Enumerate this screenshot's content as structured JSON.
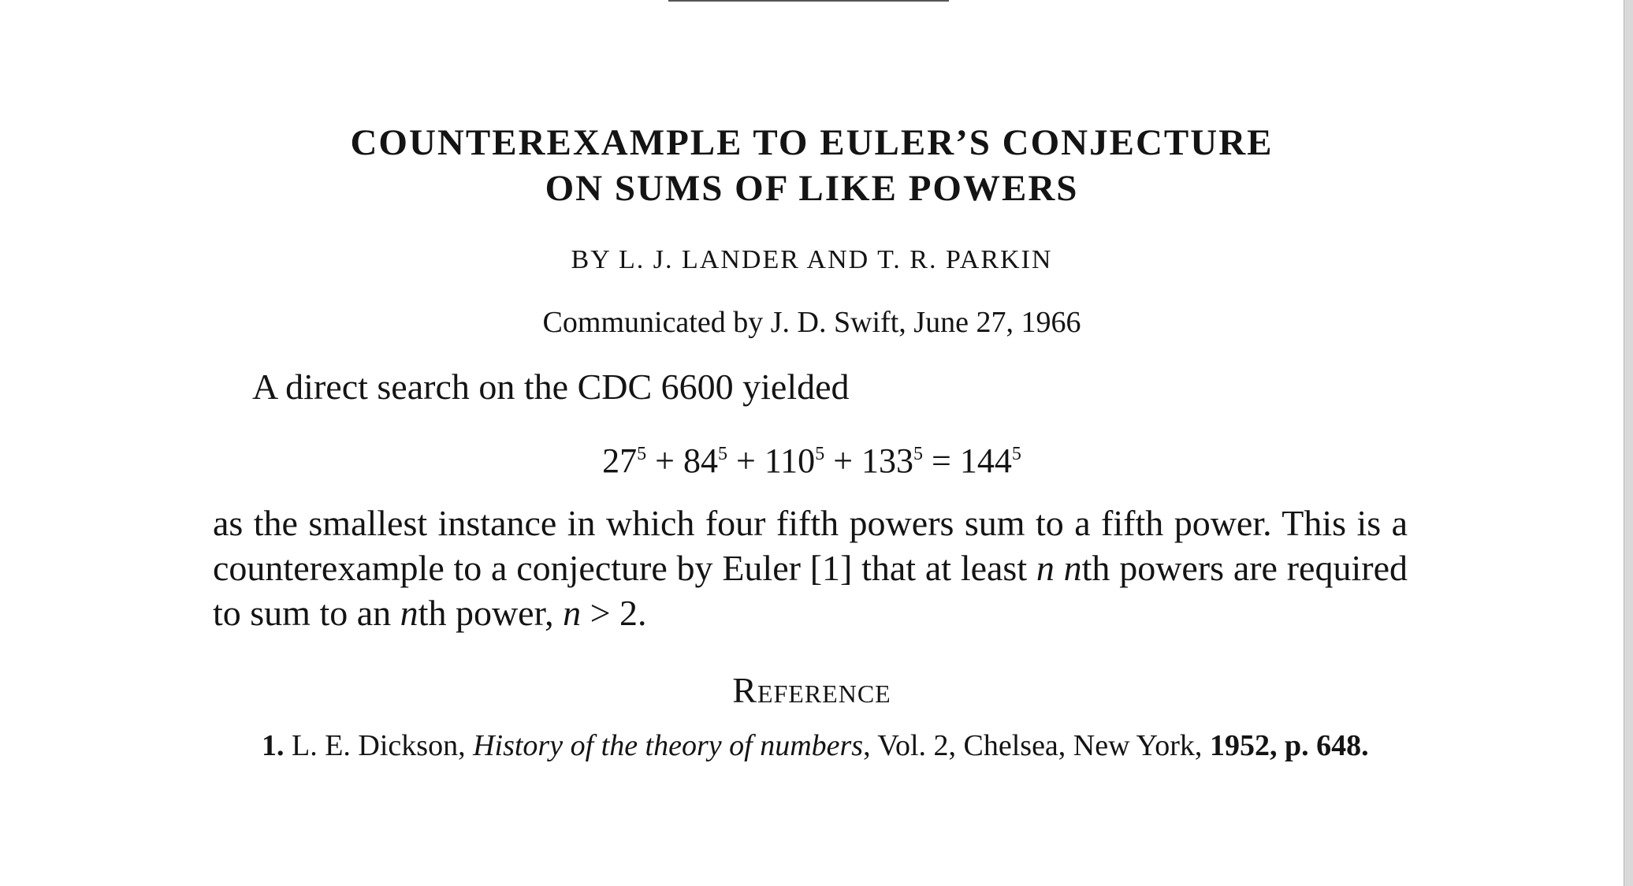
{
  "title": {
    "line1": "COUNTEREXAMPLE TO EULER’S CONJECTURE",
    "line2": "ON SUMS OF LIKE POWERS"
  },
  "authors": "BY L. J. LANDER AND T. R. PARKIN",
  "communicated": "Communicated by J. D. Swift, June 27, 1966",
  "intro": "A direct search on the CDC 6600 yielded",
  "equation": {
    "terms": [
      {
        "base": "27",
        "exp": "5"
      },
      {
        "base": "84",
        "exp": "5"
      },
      {
        "base": "110",
        "exp": "5"
      },
      {
        "base": "133",
        "exp": "5"
      }
    ],
    "result": {
      "base": "144",
      "exp": "5"
    },
    "plus": "+",
    "equals": "="
  },
  "body": {
    "part1": "as the smallest instance in which four fifth powers sum to a fifth power. This is a counterexample to a conjecture by Euler ",
    "citation": "[1]",
    "part2": " that at least ",
    "var_n": "n",
    "part3": " ",
    "var_n2": "n",
    "part4": "th powers are required to sum to an ",
    "var_n3": "n",
    "part5": "th power, ",
    "var_n4": "n",
    "part6": " > 2."
  },
  "reference_heading": "Reference",
  "reference": {
    "number": "1.",
    "author": " L. E. Dickson, ",
    "work": "History of the theory of numbers",
    "details": ", Vol. 2, Chelsea, New York, ",
    "year_page": "1952, p. 648."
  }
}
